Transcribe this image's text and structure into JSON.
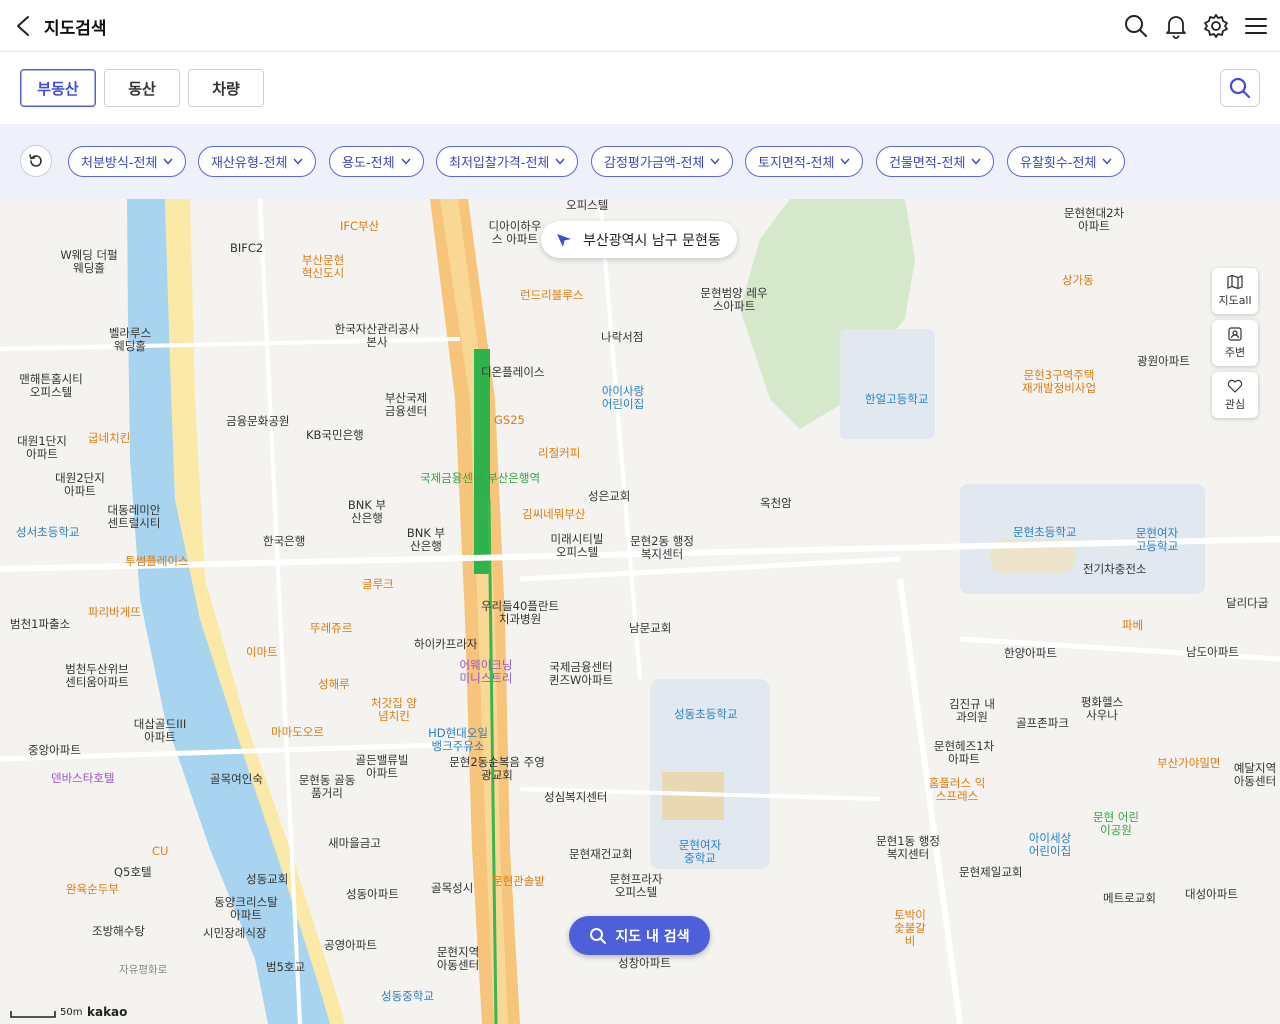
{
  "header": {
    "title": "지도검색",
    "icons": [
      "back-arrow-icon",
      "search-icon",
      "bell-icon",
      "gear-icon",
      "menu-icon"
    ]
  },
  "tabs": [
    {
      "label": "부동산",
      "active": true
    },
    {
      "label": "동산",
      "active": false
    },
    {
      "label": "차량",
      "active": false
    }
  ],
  "filters": [
    "처분방식-전체",
    "재산유형-전체",
    "용도-전체",
    "최저입찰가격-전체",
    "감정평가금액-전체",
    "토지면적-전체",
    "건물면적-전체",
    "유찰횟수-전체"
  ],
  "map": {
    "location": "부산광역시 남구 문현동",
    "side_buttons": [
      "지도all",
      "주변",
      "관심"
    ],
    "search_button": "지도 내 검색",
    "scale": "50m",
    "brand": "kakao",
    "places": [
      "IFC부산",
      "BIFC2",
      "디아이하우스 아파트",
      "오피스텔",
      "W웨딩 더펄 웨딩홀",
      "부산문현 혁신도시",
      "벨라루스 웨딩홀",
      "한국자산관리공사 본사",
      "런드리블루스",
      "문현범양 레우스아파트",
      "나락서점",
      "맨해튼홈시티 오피스텔",
      "아이사랑 어린이집",
      "디온플레이스",
      "부산국제 금융센터",
      "금융문화공원",
      "KB국민은행",
      "GS25",
      "한얼고등학교",
      "리절커피",
      "대원1단지 아파트",
      "굽네치킨",
      "대원2단지 아파트",
      "국제금융센터.부산은행역",
      "성은교회",
      "옥천암",
      "BNK 부산은행",
      "BNK 부산은행",
      "김씨네뭐부산",
      "대동레미안 센트럴시티",
      "성서초등학교",
      "한국은행",
      "미래시티빌 오피스텔",
      "문현2동 행정복지센터",
      "문현초등학교",
      "문현여자 고등학교",
      "전기차충전소",
      "투썸플레이스",
      "글루크",
      "우리들40플란트 치과병원",
      "남문교회",
      "달리다굽",
      "범천1파출소",
      "파리바게뜨",
      "뚜레쥬르",
      "하이카프라자",
      "이마트",
      "국제금융센터 퀸즈W아파트",
      "어웨이크닝 미니스트리",
      "한양아파트",
      "파베",
      "남도아파트",
      "범천두산위브 센티움아파트",
      "성해루",
      "처갓집 양념치킨",
      "김진규 내과의원",
      "골프존파크",
      "평화헬스 사우나",
      "성동초등학교",
      "대삽골드III 아파트",
      "마마도오르",
      "HD현대오일 뱅크주유소",
      "문현2동순복음 주영광교회",
      "중앙아파트",
      "덴바스타호텔",
      "골든밸류빌 아파트",
      "문현헤즈1차 아파트",
      "부산가야밀면",
      "골목여인숙",
      "문현동 골동품거리",
      "성심복지센터",
      "홈플러스 익스프레스",
      "문현 어린이공원",
      "예달지역 아동센터",
      "새마을금고",
      "문현재건교회",
      "문현여자 중학교",
      "문현1동 행정복지센터",
      "아이세상 어린이집",
      "Q5호텔",
      "완육순두부",
      "성동교회",
      "문현관솔밭",
      "문현프라자 오피스텔",
      "문현제일교회",
      "메트로교회",
      "대성아파트",
      "동양크리스탈 아파트",
      "성동아파트",
      "골목성시",
      "조방해수탕",
      "시민장례식장",
      "공영아파트",
      "문현지역 아동센터",
      "성창아파트",
      "토박이 숯불갈비",
      "범5호교",
      "성동중학교",
      "자유평화로",
      "광원아파트",
      "문현3구역주택 재개발정비사업",
      "상가동",
      "문현현대2차 아파트",
      "CU"
    ]
  }
}
